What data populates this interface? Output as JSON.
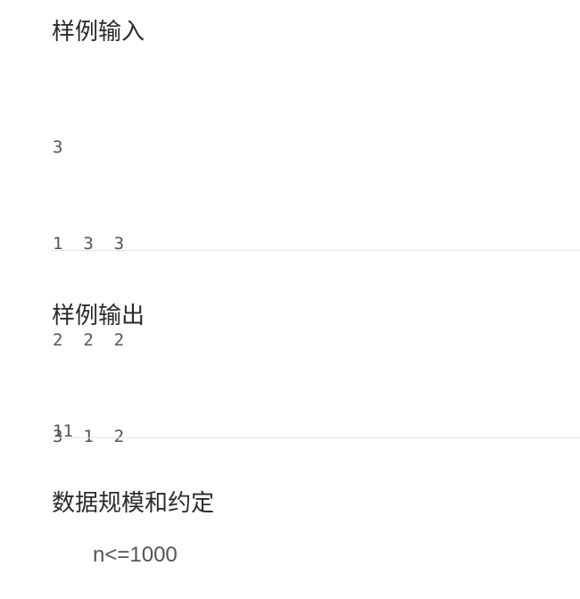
{
  "sample_input": {
    "heading": "样例输入",
    "lines": [
      "3",
      "1  3  3",
      "2  2  2",
      "3  1  2"
    ]
  },
  "sample_output": {
    "heading": "样例输出",
    "lines": [
      "11"
    ]
  },
  "constraints": {
    "heading": "数据规模和约定",
    "text": "n<=1000"
  }
}
